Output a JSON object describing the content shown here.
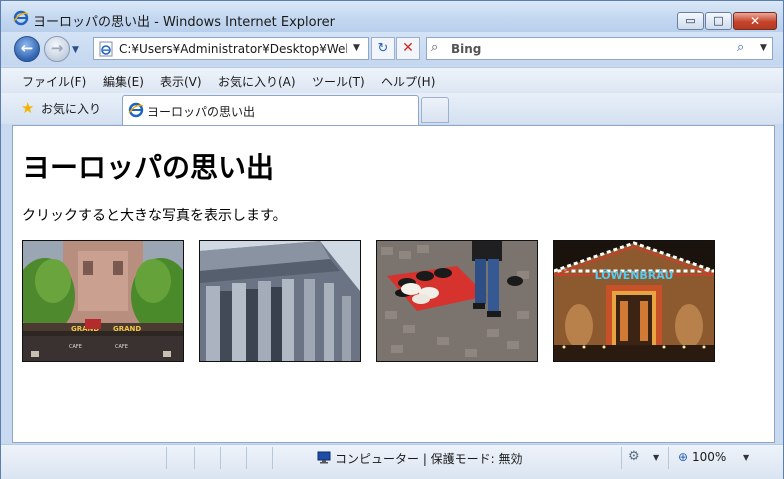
{
  "window": {
    "title": "ヨーロッパの思い出 - Windows Internet Explorer",
    "minimize_glyph": "▭",
    "maximize_glyph": "□",
    "close_glyph": "✕"
  },
  "nav": {
    "back_glyph": "←",
    "forward_glyph": "→",
    "dropdown_glyph": "▼"
  },
  "address": {
    "url": "C:¥Users¥Administrator¥Desktop¥Web¥",
    "dropdown_glyph": "▼",
    "refresh_glyph": "↻",
    "stop_glyph": "✕"
  },
  "search": {
    "placeholder": "Bing",
    "icon_glyph": "⌕",
    "go_glyph": "⌕",
    "dropdown_glyph": "▼"
  },
  "menu": [
    {
      "label": "ファイル(F)"
    },
    {
      "label": "編集(E)"
    },
    {
      "label": "表示(V)"
    },
    {
      "label": "お気に入り(A)"
    },
    {
      "label": "ツール(T)"
    },
    {
      "label": "ヘルプ(H)"
    }
  ],
  "favorites": {
    "label": "お気に入り",
    "star_glyph": "★"
  },
  "tab": {
    "label": "ヨーロッパの思い出"
  },
  "page": {
    "heading": "ヨーロッパの思い出",
    "description": "クリックすると大きな写真を表示します。",
    "thumbnails": [
      {
        "name": "grand-cafe-photo",
        "sign_text": "GRAND",
        "sub_text": "CAFE"
      },
      {
        "name": "pantheon-columns-photo"
      },
      {
        "name": "hat-vendor-cobblestone-photo"
      },
      {
        "name": "lowenbrau-tent-photo",
        "sign_text": "LÖWENBRÄU"
      }
    ]
  },
  "status": {
    "zone": "コンピューター | 保護モード: 無効",
    "zoom": "100%",
    "zoom_glyph": "⊕",
    "addon_glyph": "⚙",
    "dropdown_glyph": "▼"
  },
  "colors": {
    "ie_blue": "#1e63c4",
    "accent_orange": "#f0a800",
    "close_red": "#c6432b"
  }
}
